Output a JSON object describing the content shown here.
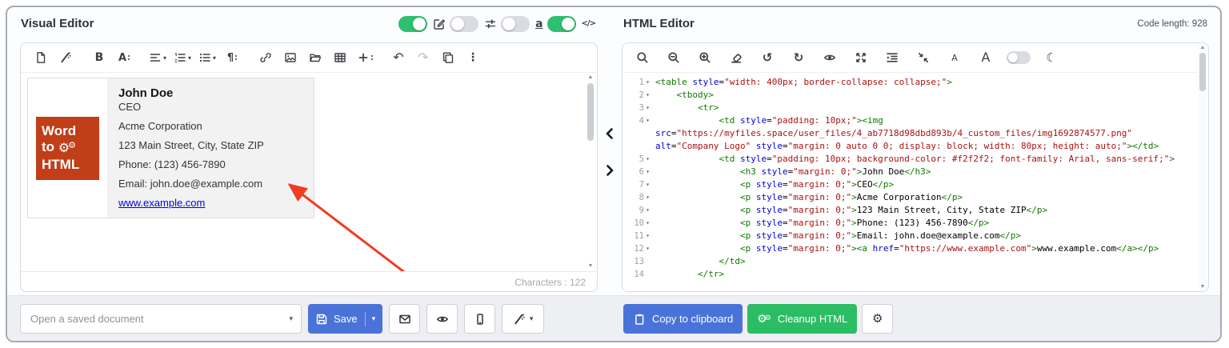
{
  "visual_editor": {
    "title": "Visual Editor",
    "toggles": [
      {
        "name": "toggle-visual-edit",
        "icon": "edit-square-icon",
        "on": true
      },
      {
        "name": "toggle-settings",
        "icon": "sliders-icon",
        "on": false
      },
      {
        "name": "toggle-entities",
        "icon": "underline-a-icon",
        "on": false
      },
      {
        "name": "toggle-code-view",
        "icon": "code-icon",
        "on": true
      }
    ],
    "toolbar_groups": [
      {
        "items": [
          {
            "icon": "new-document-icon",
            "name": "new-document-button"
          },
          {
            "icon": "magic-wand-icon",
            "name": "magic-wand-button"
          }
        ]
      },
      {
        "items": [
          {
            "icon": "bold-icon",
            "name": "bold-button"
          },
          {
            "icon": "font-size-icon",
            "name": "font-size-button",
            "dots": true
          }
        ]
      },
      {
        "items": [
          {
            "icon": "align-icon",
            "name": "align-button",
            "caret": true
          },
          {
            "icon": "ordered-list-icon",
            "name": "ordered-list-button",
            "caret": true
          },
          {
            "icon": "unordered-list-icon",
            "name": "unordered-list-button",
            "caret": true
          },
          {
            "icon": "paragraph-icon",
            "name": "paragraph-button",
            "dots": true
          }
        ]
      },
      {
        "items": [
          {
            "icon": "link-icon",
            "name": "insert-link-button"
          },
          {
            "icon": "image-icon",
            "name": "insert-image-button"
          },
          {
            "icon": "folder-icon",
            "name": "open-file-button"
          },
          {
            "icon": "table-icon",
            "name": "insert-table-button"
          },
          {
            "icon": "plus-icon",
            "name": "insert-more-button",
            "dots": true
          }
        ]
      },
      {
        "items": [
          {
            "icon": "undo-arrow-icon",
            "name": "undo-button"
          },
          {
            "icon": "redo-arrow-icon",
            "name": "redo-button",
            "disabled": true
          },
          {
            "icon": "copy-icon",
            "name": "duplicate-button"
          },
          {
            "icon": "more-vertical-icon",
            "name": "more-options-button"
          }
        ]
      }
    ],
    "card": {
      "logo": [
        "Word",
        "to",
        "HTML"
      ],
      "name": "John Doe",
      "role": "CEO",
      "company": "Acme Corporation",
      "address": "123 Main Street, City, State ZIP",
      "phone": "Phone: (123) 456-7890",
      "email": "Email: john.doe@example.com",
      "website": "www.example.com"
    },
    "characters_label": "Characters : 122"
  },
  "html_editor": {
    "title": "HTML Editor",
    "code_length_label": "Code length: 928",
    "toolbar_groups": [
      {
        "items": [
          {
            "icon": "search-icon",
            "name": "search-button"
          },
          {
            "icon": "zoom-out-icon",
            "name": "zoom-out-button"
          },
          {
            "icon": "zoom-in-icon",
            "name": "zoom-in-button"
          },
          {
            "icon": "eraser-icon",
            "name": "clear-button"
          },
          {
            "icon": "undo-rotate-icon",
            "name": "undo-button"
          },
          {
            "icon": "redo-rotate-icon",
            "name": "redo-button"
          },
          {
            "icon": "eye-icon",
            "name": "preview-button"
          },
          {
            "icon": "expand-icon",
            "name": "fullscreen-button"
          },
          {
            "icon": "indent-icon",
            "name": "auto-indent-button"
          },
          {
            "icon": "collapse-icon",
            "name": "collapse-button"
          },
          {
            "icon": "font-decrease-icon",
            "name": "font-decrease-button"
          },
          {
            "icon": "font-increase-icon",
            "name": "font-increase-button"
          },
          {
            "icon": "theme-toggle",
            "name": "dark-mode-toggle"
          },
          {
            "icon": "moon-icon",
            "name": "moon-button"
          }
        ]
      }
    ],
    "code_lines": [
      {
        "n": 1,
        "fold": true,
        "text": "<table style=\"width: 400px; border-collapse: collapse;\">"
      },
      {
        "n": 2,
        "fold": true,
        "text": "    <tbody>"
      },
      {
        "n": 3,
        "fold": true,
        "text": "        <tr>"
      },
      {
        "n": 4,
        "fold": true,
        "text": "            <td style=\"padding: 10px;\"><img src=\"https://myfiles.space/user_files/4_ab7718d98dbd893b/4_custom_files/img1692874577.png\" alt=\"Company Logo\" style=\"margin: 0 auto 0 0; display: block; width: 80px; height: auto;\"></td>"
      },
      {
        "n": 5,
        "fold": true,
        "text": "            <td style=\"padding: 10px; background-color: #f2f2f2; font-family: Arial, sans-serif;\">"
      },
      {
        "n": 6,
        "fold": true,
        "text": "                <h3 style=\"margin: 0;\">John Doe</h3>"
      },
      {
        "n": 7,
        "fold": true,
        "text": "                <p style=\"margin: 0;\">CEO</p>"
      },
      {
        "n": 8,
        "fold": true,
        "text": "                <p style=\"margin: 0;\">Acme Corporation</p>"
      },
      {
        "n": 9,
        "fold": true,
        "text": "                <p style=\"margin: 0;\">123 Main Street, City, State ZIP</p>"
      },
      {
        "n": 10,
        "fold": true,
        "text": "                <p style=\"margin: 0;\">Phone: (123) 456-7890</p>"
      },
      {
        "n": 11,
        "fold": true,
        "text": "                <p style=\"margin: 0;\">Email: john.doe@example.com</p>"
      },
      {
        "n": 12,
        "fold": true,
        "text": "                <p style=\"margin: 0;\"><a href=\"https://www.example.com\">www.example.com</a></p>"
      },
      {
        "n": 13,
        "fold": false,
        "text": "            </td>"
      },
      {
        "n": 14,
        "fold": false,
        "text": "        </tr>"
      }
    ]
  },
  "footer": {
    "open_placeholder": "Open a saved document",
    "save": {
      "label": "Save",
      "icon": "floppy-icon"
    },
    "quick_buttons": [
      {
        "icon": "envelope-icon",
        "name": "email-button"
      },
      {
        "icon": "eye-icon",
        "name": "preview-button"
      },
      {
        "icon": "mobile-icon",
        "name": "mobile-preview-button"
      },
      {
        "icon": "magic-wand-icon",
        "name": "magic-wand-button",
        "caret": true
      }
    ],
    "copy": {
      "label": "Copy to clipboard",
      "icon": "clipboard-icon"
    },
    "cleanup": {
      "label": "Cleanup HTML",
      "icon": "gears-icon"
    },
    "settings_icon": "gear-icon"
  },
  "colors": {
    "toggle_green": "#2fbf71",
    "button_blue": "#4a73d9",
    "button_green": "#2bbd63",
    "logo_orange": "#c03e18",
    "card_background": "#f2f2f2",
    "link_blue": "#0000ee",
    "arrow_red": "#ef3c23",
    "code_tag": "#117700",
    "code_attribute": "#0000cc",
    "code_string": "#aa1111"
  }
}
